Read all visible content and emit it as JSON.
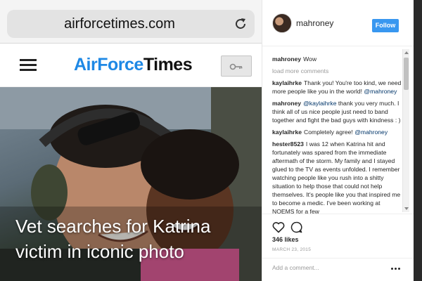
{
  "browser": {
    "url": "airforcetimes.com",
    "reload_icon": "reload-icon"
  },
  "site": {
    "menu_icon": "hamburger-icon",
    "logo_part1": "AirForce",
    "logo_part2": "Times",
    "key_icon": "key-icon"
  },
  "article": {
    "headline_line1": "Vet searches for Katrina",
    "headline_line2": "victim in iconic photo"
  },
  "instagram": {
    "username": "mahroney",
    "follow_label": "Follow",
    "first_comment": {
      "user": "mahroney",
      "text": "Wow"
    },
    "load_more": "load more comments",
    "comments": [
      {
        "user": "kaylaihrke",
        "text": "Thank you! You're too kind, we need more people like you in the world!",
        "mention": "@mahroney"
      },
      {
        "user": "mahroney",
        "mention": "@kaylaihrke",
        "text": "thank you very much. I think all of us nice people just need to band together and fight the bad guys with kindness : )"
      },
      {
        "user": "kaylaihrke",
        "text": "Completely agree!",
        "mention": "@mahroney"
      },
      {
        "user": "hester8523",
        "text": "I was 12 when Katrina hit and fortunately was spared from the immediate aftermath of the storm. My family and I stayed glued to the TV as events unfolded. I remember watching people like you rush into a shitty situation to help those that could not help themselves. It's people like you that inspired me to become a medic. I've been working at NOEMS for a few"
      }
    ],
    "likes": "346 likes",
    "date": "MARCH 23, 2015",
    "add_comment_placeholder": "Add a comment...",
    "icons": [
      "heart-icon",
      "comment-icon",
      "more-icon"
    ],
    "colors": {
      "follow": "#3897f0",
      "logo_blue": "#1e88e5"
    }
  }
}
